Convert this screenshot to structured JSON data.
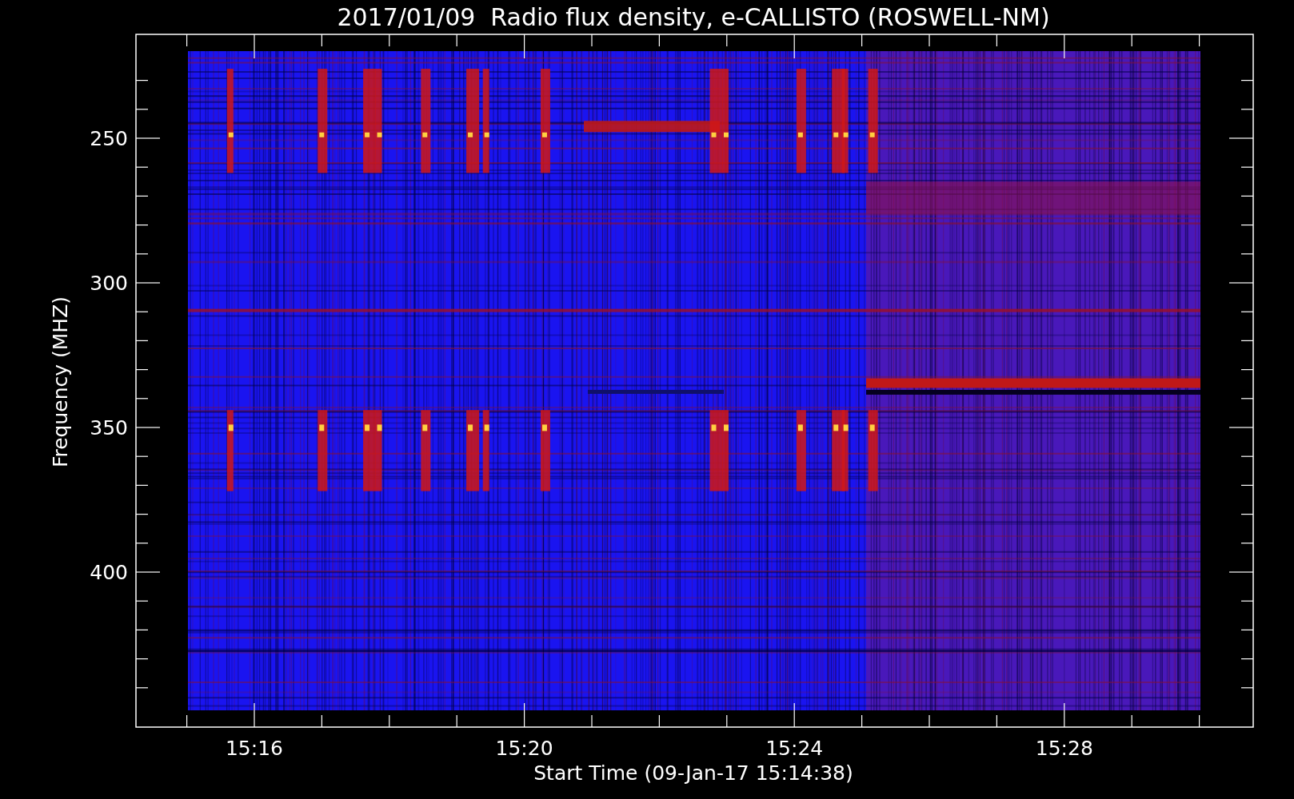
{
  "chart": {
    "title": "2017/01/09  Radio flux density, e-CALLISTO (ROSWELL-NM)",
    "ylabel": "Frequency (MHZ)",
    "xlabel": "Start Time (09-Jan-17 15:14:38)",
    "yticks": [
      "250",
      "300",
      "350",
      "400"
    ],
    "xticks": [
      "15:16",
      "15:20",
      "15:24",
      "15:28"
    ]
  }
}
